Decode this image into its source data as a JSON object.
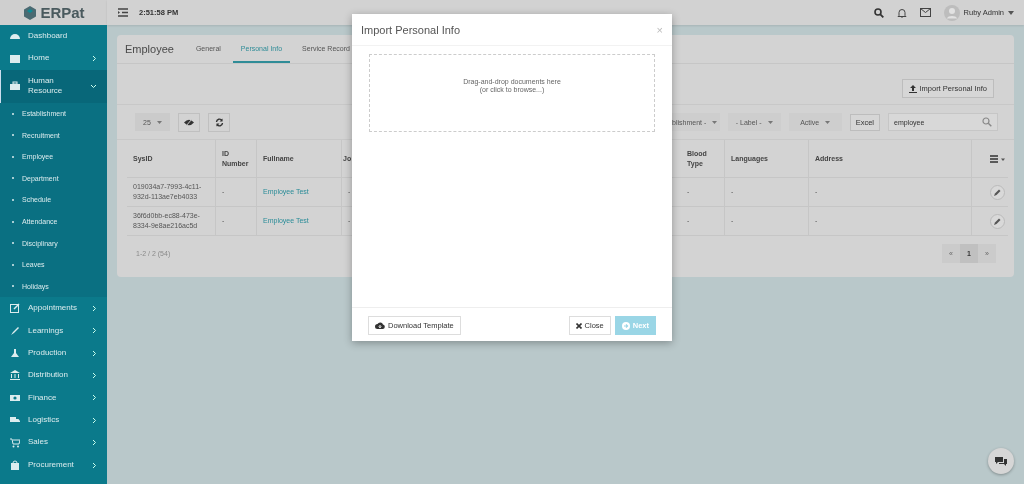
{
  "sidebar": {
    "logo": "ERPat",
    "items": [
      {
        "label": "Dashboard",
        "kind": "link",
        "expanded": false
      },
      {
        "label": "Home",
        "kind": "menu",
        "expanded": false
      },
      {
        "label": "Human Resource",
        "kind": "menu",
        "expanded": true,
        "children": [
          {
            "label": "Establishment"
          },
          {
            "label": "Recruitment"
          },
          {
            "label": "Employee"
          },
          {
            "label": "Department"
          },
          {
            "label": "Schedule"
          },
          {
            "label": "Attendance"
          },
          {
            "label": "Disciplinary"
          },
          {
            "label": "Leaves"
          },
          {
            "label": "Holidays"
          }
        ]
      },
      {
        "label": "Appointments",
        "kind": "menu",
        "expanded": false
      },
      {
        "label": "Learnings",
        "kind": "menu",
        "expanded": false
      },
      {
        "label": "Production",
        "kind": "menu",
        "expanded": false
      },
      {
        "label": "Distribution",
        "kind": "menu",
        "expanded": false
      },
      {
        "label": "Finance",
        "kind": "menu",
        "expanded": false
      },
      {
        "label": "Logistics",
        "kind": "menu",
        "expanded": false
      },
      {
        "label": "Sales",
        "kind": "menu",
        "expanded": false
      },
      {
        "label": "Procurement",
        "kind": "menu",
        "expanded": false
      }
    ]
  },
  "topbar": {
    "time": "2:51:58 PM",
    "user": "Ruby Admin"
  },
  "page": {
    "title": "Employee",
    "tabs": [
      {
        "label": "General",
        "selected": false
      },
      {
        "label": "Personal Info",
        "selected": true
      },
      {
        "label": "Service Record",
        "selected": false
      }
    ],
    "import_button": "Import Personal Info",
    "toolbar": {
      "page_size": "25",
      "filters": [
        "blishment -",
        "- Label -",
        "Active"
      ],
      "excel": "Excel",
      "search_value": "employee"
    },
    "table": {
      "columns": [
        "SysID",
        "ID Number",
        "Fullname",
        "Jo",
        "Blood Type",
        "Languages",
        "Address"
      ],
      "rows": [
        {
          "cells": [
            {
              "text": "019034a7-7993-4c11-932d-113ae7eb4033",
              "kind": "text"
            },
            {
              "text": "-",
              "kind": "text"
            },
            {
              "text": "Employee Test",
              "kind": "link"
            },
            {
              "text": "-",
              "kind": "text"
            },
            {
              "text": "-",
              "kind": "text"
            },
            {
              "text": "-",
              "kind": "text"
            },
            {
              "text": "-",
              "kind": "text"
            }
          ]
        },
        {
          "cells": [
            {
              "text": "36f6d0bb-ec88-473e-8334-9e8ae216ac5d",
              "kind": "text"
            },
            {
              "text": "-",
              "kind": "text"
            },
            {
              "text": "Employee Test",
              "kind": "link"
            },
            {
              "text": "-",
              "kind": "text"
            },
            {
              "text": "-",
              "kind": "text"
            },
            {
              "text": "-",
              "kind": "text"
            },
            {
              "text": "-",
              "kind": "text"
            }
          ]
        }
      ]
    },
    "summary": "1-2 / 2 (54)",
    "pagination": {
      "prev": "«",
      "pages": [
        {
          "label": "1",
          "selected": true
        }
      ],
      "next": "»"
    }
  },
  "modal": {
    "title": "Import Personal Info",
    "close": "×",
    "dropzone": [
      "Drag-and-drop documents here",
      "(or click to browse...)"
    ],
    "buttons": [
      {
        "label": "Download Template",
        "kind": "download",
        "disabled": false
      },
      {
        "label": "Close",
        "kind": "close",
        "disabled": false
      },
      {
        "label": "Next",
        "kind": "next",
        "disabled": true
      }
    ]
  }
}
